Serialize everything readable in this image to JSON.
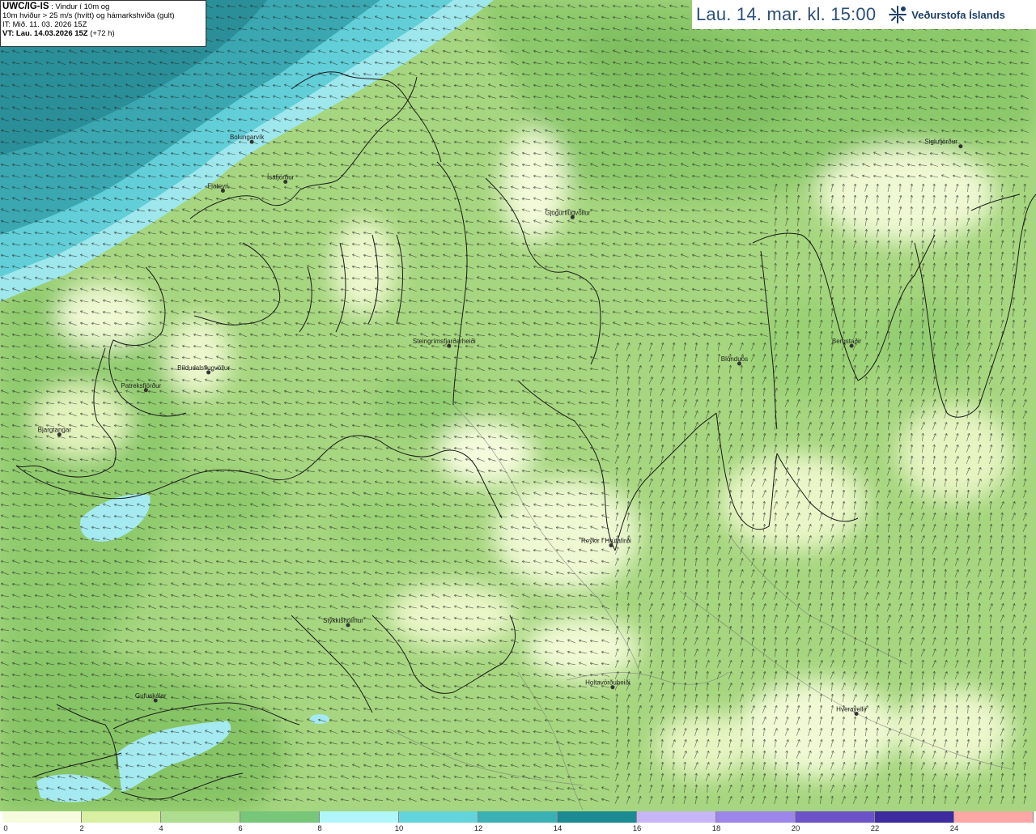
{
  "header": {
    "model_name": "UWC/IG-IS",
    "model_desc": " : Vindur í 10m og",
    "line2": "10m hviður > 25 m/s (hvítt) og hámarkshviða (gult)",
    "line3": "IT: Mið. 11. 03. 2026 15Z",
    "vt_label": "VT: Lau. 14.03.2026 15Z",
    "vt_offset": " (+72 h)"
  },
  "title": "Lau. 14. mar. kl. 15:00",
  "logo": {
    "text": "Veðurstofa Íslands",
    "icon": "snowflake-icon"
  },
  "places": [
    {
      "name": "Bolungarvík",
      "lonlat": [
        -23.33,
        66.16
      ]
    },
    {
      "name": "Flateyri",
      "lonlat": [
        -23.51,
        66.05
      ]
    },
    {
      "name": "Ísafjörður",
      "lonlat": [
        -23.12,
        66.07
      ]
    },
    {
      "name": "Gjögurflugvöllur",
      "lonlat": [
        -21.33,
        65.99
      ]
    },
    {
      "name": "Siglufjörður",
      "lonlat": [
        -18.91,
        66.15
      ]
    },
    {
      "name": "Bíldudalsflugvöllur",
      "lonlat": [
        -23.6,
        65.64
      ]
    },
    {
      "name": "Patreksfjörður",
      "lonlat": [
        -23.99,
        65.6
      ]
    },
    {
      "name": "Bjargtangar",
      "lonlat": [
        -24.53,
        65.5
      ]
    },
    {
      "name": "Steingrímsfjarðarheiði",
      "lonlat": [
        -22.1,
        65.7
      ]
    },
    {
      "name": "Blönduós",
      "lonlat": [
        -20.29,
        65.66
      ]
    },
    {
      "name": "Bergstaðir",
      "lonlat": [
        -19.59,
        65.7
      ]
    },
    {
      "name": "Reykir í Hrútafirði",
      "lonlat": [
        -21.09,
        65.25
      ]
    },
    {
      "name": "Stykkishólmur",
      "lonlat": [
        -22.73,
        65.07
      ]
    },
    {
      "name": "Holtavörðuheiði",
      "lonlat": [
        -21.08,
        64.93
      ]
    },
    {
      "name": "Gufuskálar",
      "lonlat": [
        -23.93,
        64.9
      ]
    },
    {
      "name": "Hveravellir",
      "lonlat": [
        -19.56,
        64.87
      ]
    }
  ],
  "colorbar": {
    "ticks": [
      "0",
      "2",
      "4",
      "6",
      "8",
      "10",
      "12",
      "14",
      "16",
      "18",
      "20",
      "22",
      "24"
    ],
    "colors": [
      "#f7fcdf",
      "#d9f0a3",
      "#addd8e",
      "#78c679",
      "#b0f5fa",
      "#63d3dc",
      "#3bb1b6",
      "#1b8a93",
      "#c7b6f7",
      "#9d86ea",
      "#6c53c8",
      "#3e2ba0",
      "#fca6a6"
    ]
  }
}
